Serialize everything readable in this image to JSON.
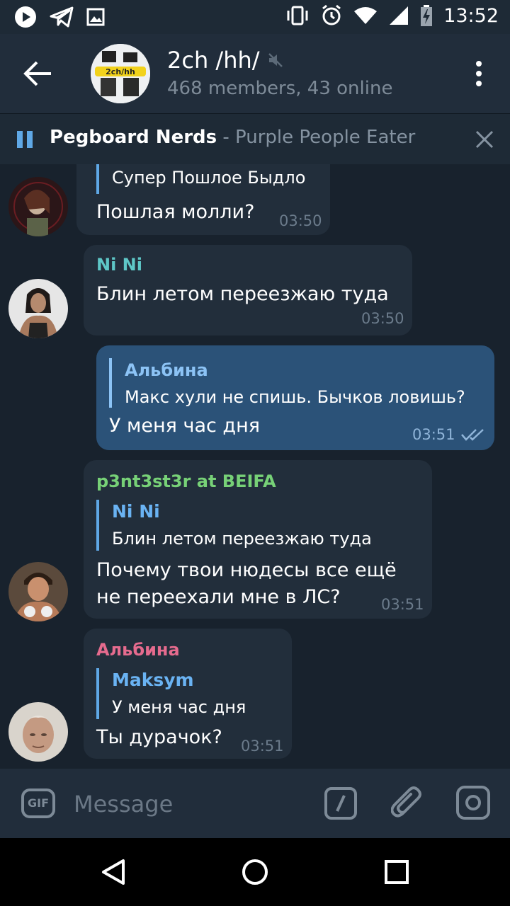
{
  "status_bar": {
    "time": "13:52"
  },
  "header": {
    "title": "2ch /hh/",
    "subtitle": "468 members, 43 online",
    "avatar_text": "2ch/hh"
  },
  "player": {
    "artist": "Pegboard Nerds",
    "separator": " - ",
    "track": "Purple People Eater"
  },
  "messages": [
    {
      "direction": "in",
      "reply_text": "Супер Пошлое Быдло",
      "text": "Пошлая молли?",
      "time": "03:50"
    },
    {
      "direction": "in",
      "sender": "Ni Ni",
      "sender_color": "#5ec7c7",
      "text": "Блин летом переезжаю туда",
      "time": "03:50"
    },
    {
      "direction": "out",
      "reply_name": "Альбина",
      "reply_text": "Макс хули не спишь. Бычков ловишь?",
      "text": "У меня час дня",
      "time": "03:51"
    },
    {
      "direction": "in",
      "sender": "p3nt3st3r at BEIFA",
      "sender_color": "#77d177",
      "reply_name": "Ni Ni",
      "reply_text": "Блин летом переезжаю туда",
      "text_line1": "Почему твои нюдесы все ещё",
      "text_line2": "не переехали мне в ЛС?",
      "time": "03:51"
    },
    {
      "direction": "in",
      "sender": "Альбина",
      "sender_color": "#e66b8e",
      "reply_name": "Maksym",
      "reply_text": "У меня час дня",
      "text": "Ты дурачок?",
      "time": "03:51"
    }
  ],
  "input": {
    "gif_label": "GIF",
    "placeholder": "Message"
  },
  "colors": {
    "background": "#18222d",
    "bubble_in": "#222e3b",
    "bubble_out": "#2b5278",
    "accent": "#5fa8e6"
  }
}
